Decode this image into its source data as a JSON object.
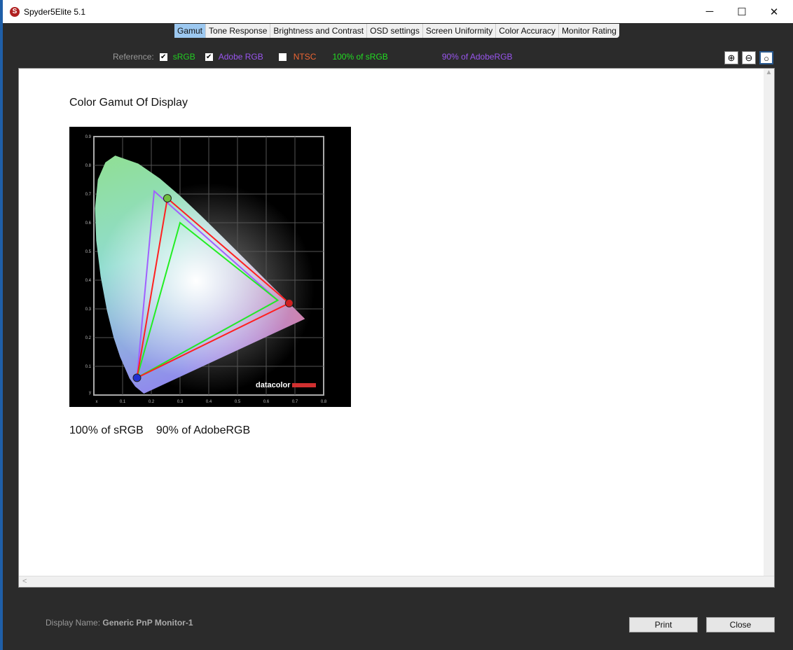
{
  "window": {
    "title": "Spyder5Elite 5.1",
    "minimize": "─",
    "maximize": "☐",
    "close": "✕"
  },
  "tabs": [
    "Gamut",
    "Tone Response",
    "Brightness and Contrast",
    "OSD settings",
    "Screen Uniformity",
    "Color Accuracy",
    "Monitor Rating"
  ],
  "reference": {
    "label": "Reference:",
    "items": [
      {
        "label": "sRGB",
        "checked": true,
        "color": "#22cc22"
      },
      {
        "label": "Adobe RGB",
        "checked": true,
        "color": "#9955ee"
      },
      {
        "label": "NTSC",
        "checked": false,
        "color": "#ee6633"
      }
    ],
    "srgb_pct": "100% of sRGB",
    "adobe_pct": "90% of AdobeRGB"
  },
  "content": {
    "title": "Color Gamut Of Display",
    "summary_srgb": "100% of sRGB",
    "summary_adobe": "90% of AdobeRGB"
  },
  "chart": {
    "logo": "datacolor",
    "x_ticks": [
      "x",
      "0.1",
      "0.2",
      "0.3",
      "0.4",
      "0.5",
      "0.6",
      "0.7",
      "0.8"
    ],
    "y_ticks": [
      "y",
      "0.1",
      "0.2",
      "0.3",
      "0.4",
      "0.5",
      "0.6",
      "0.7",
      "0.8",
      "0.9"
    ],
    "display": [
      [
        0.68,
        0.32
      ],
      [
        0.256,
        0.685
      ],
      [
        0.15,
        0.06
      ]
    ],
    "srgb": [
      [
        0.64,
        0.33
      ],
      [
        0.3,
        0.6
      ],
      [
        0.15,
        0.06
      ]
    ],
    "adobe": [
      [
        0.64,
        0.33
      ],
      [
        0.21,
        0.71
      ],
      [
        0.15,
        0.06
      ]
    ]
  },
  "footer": {
    "display_name_label": "Display Name:",
    "display_name": "Generic PnP Monitor-1",
    "print": "Print",
    "close": "Close"
  }
}
